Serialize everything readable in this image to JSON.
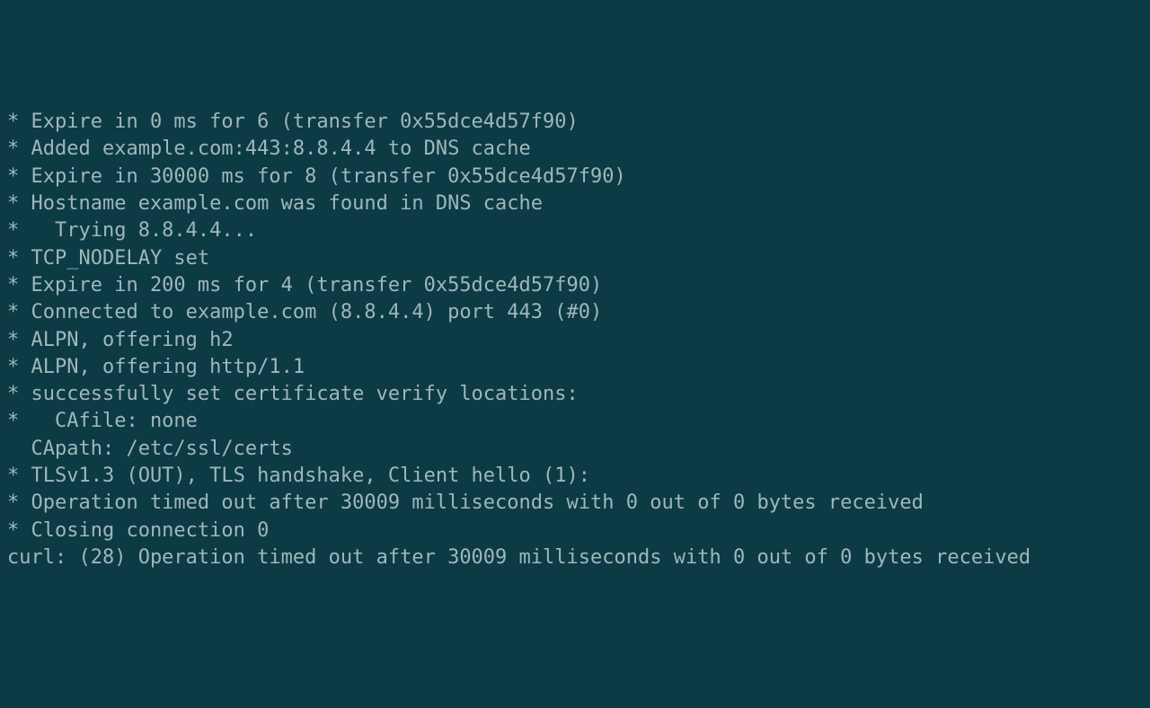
{
  "terminal": {
    "lines": [
      "* Expire in 0 ms for 6 (transfer 0x55dce4d57f90)",
      "* Added example.com:443:8.8.4.4 to DNS cache",
      "* Expire in 30000 ms for 8 (transfer 0x55dce4d57f90)",
      "* Hostname example.com was found in DNS cache",
      "*   Trying 8.8.4.4...",
      "* TCP_NODELAY set",
      "* Expire in 200 ms for 4 (transfer 0x55dce4d57f90)",
      "* Connected to example.com (8.8.4.4) port 443 (#0)",
      "* ALPN, offering h2",
      "* ALPN, offering http/1.1",
      "* successfully set certificate verify locations:",
      "*   CAfile: none",
      "  CApath: /etc/ssl/certs",
      "* TLSv1.3 (OUT), TLS handshake, Client hello (1):",
      "* Operation timed out after 30009 milliseconds with 0 out of 0 bytes received",
      "* Closing connection 0",
      "curl: (28) Operation timed out after 30009 milliseconds with 0 out of 0 bytes received"
    ]
  }
}
